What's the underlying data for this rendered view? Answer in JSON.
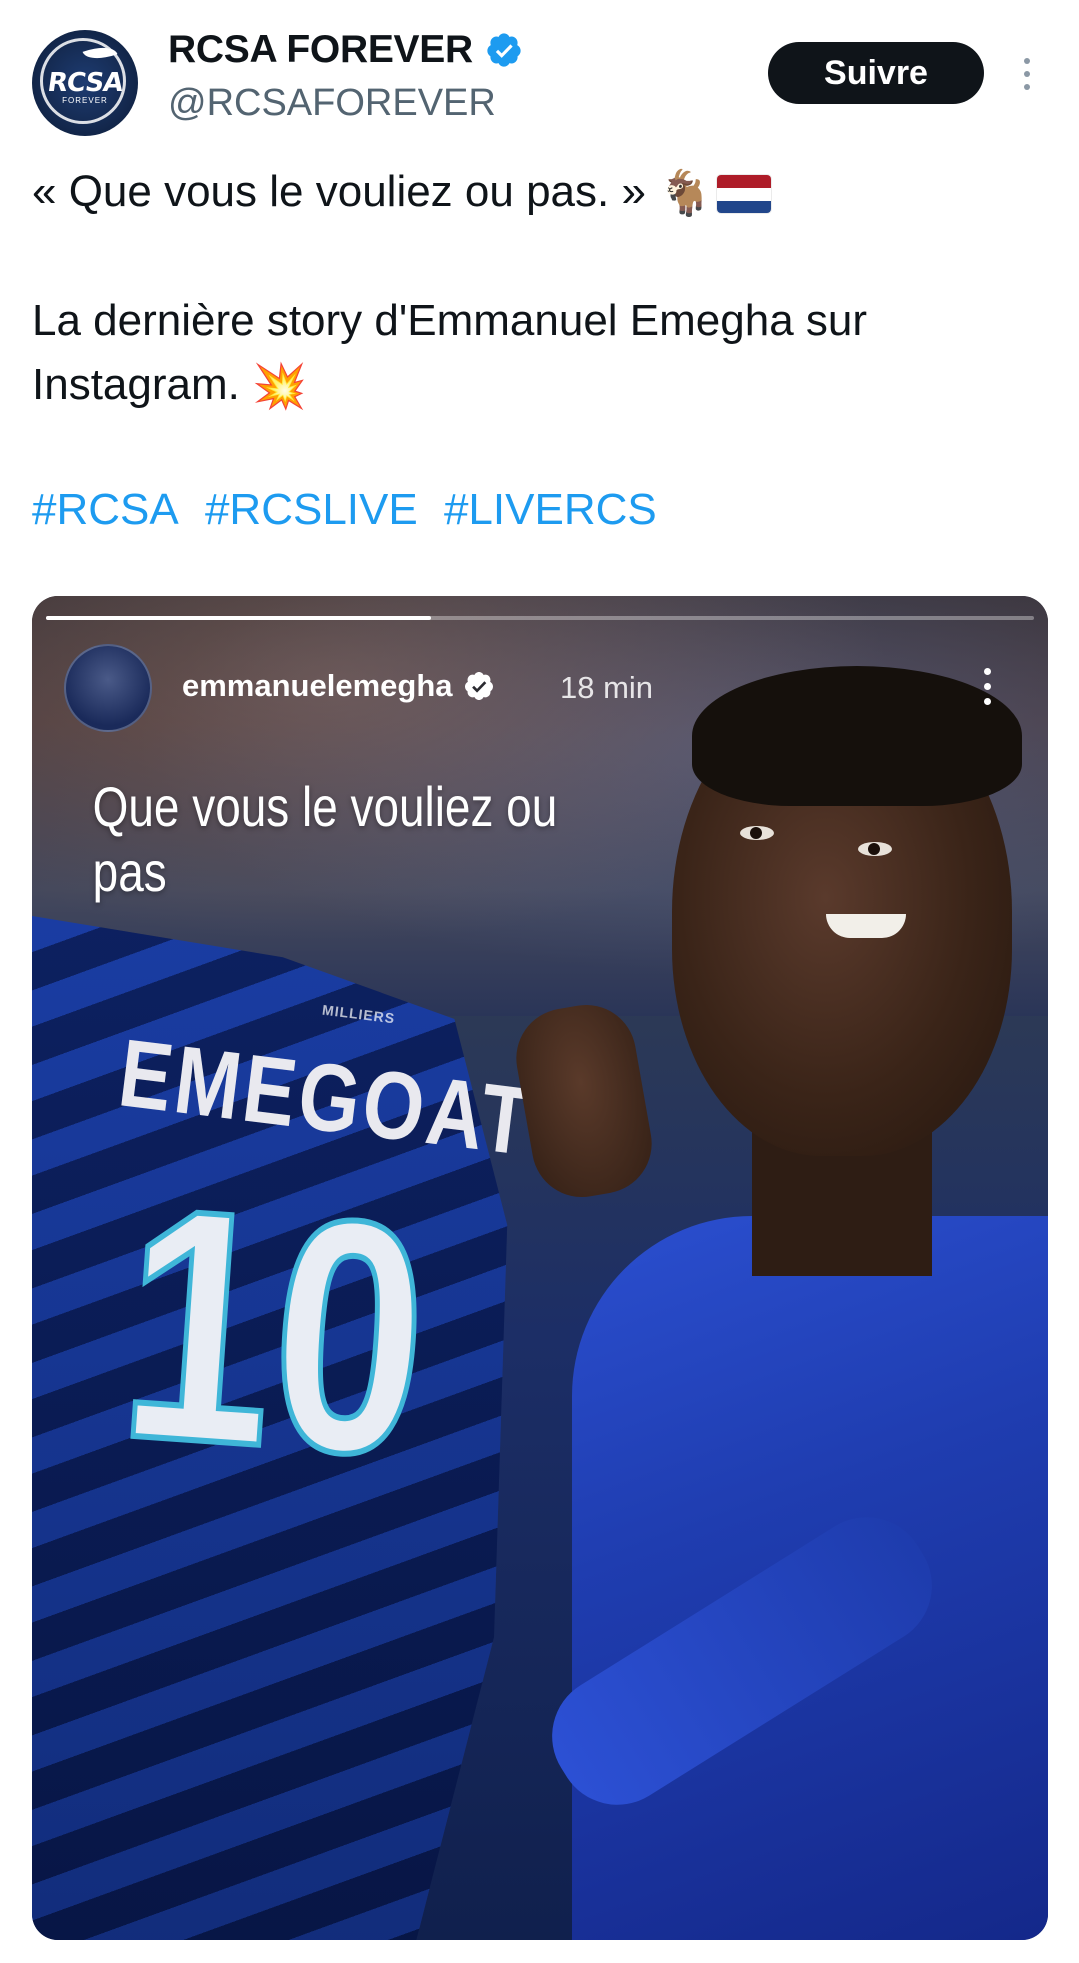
{
  "header": {
    "account_name": "RCSA FOREVER",
    "handle": "@RCSAFOREVER",
    "follow_label": "Suivre",
    "avatar_logo_text": "RCSA",
    "avatar_logo_subtext": "FOREVER"
  },
  "tweet": {
    "line1": "« Que vous le vouliez ou pas. »",
    "line1_emoji": "🐐",
    "line2": "La dernière story d'Emmanuel Emegha sur Instagram.",
    "line2_emoji": "💥",
    "hashtags": [
      "#RCSA",
      "#RCSLIVE",
      "#LIVERCS"
    ]
  },
  "story": {
    "username": "emmanuelemegha",
    "time": "18 min",
    "caption": "Que vous le vouliez ou pas",
    "progress_fraction": 0.39,
    "jersey_name": "EMEGOAT",
    "jersey_number": "10",
    "jersey_small_text": "MILLIERS"
  },
  "colors": {
    "link": "#1d9bf0",
    "verified": "#1d9bf0",
    "text": "#0f1419",
    "secondary": "#536471",
    "button": "#0f1419"
  },
  "icons": {
    "verified": "verified-badge-icon",
    "more": "more-vertical-icon",
    "flag": "netherlands-flag"
  }
}
